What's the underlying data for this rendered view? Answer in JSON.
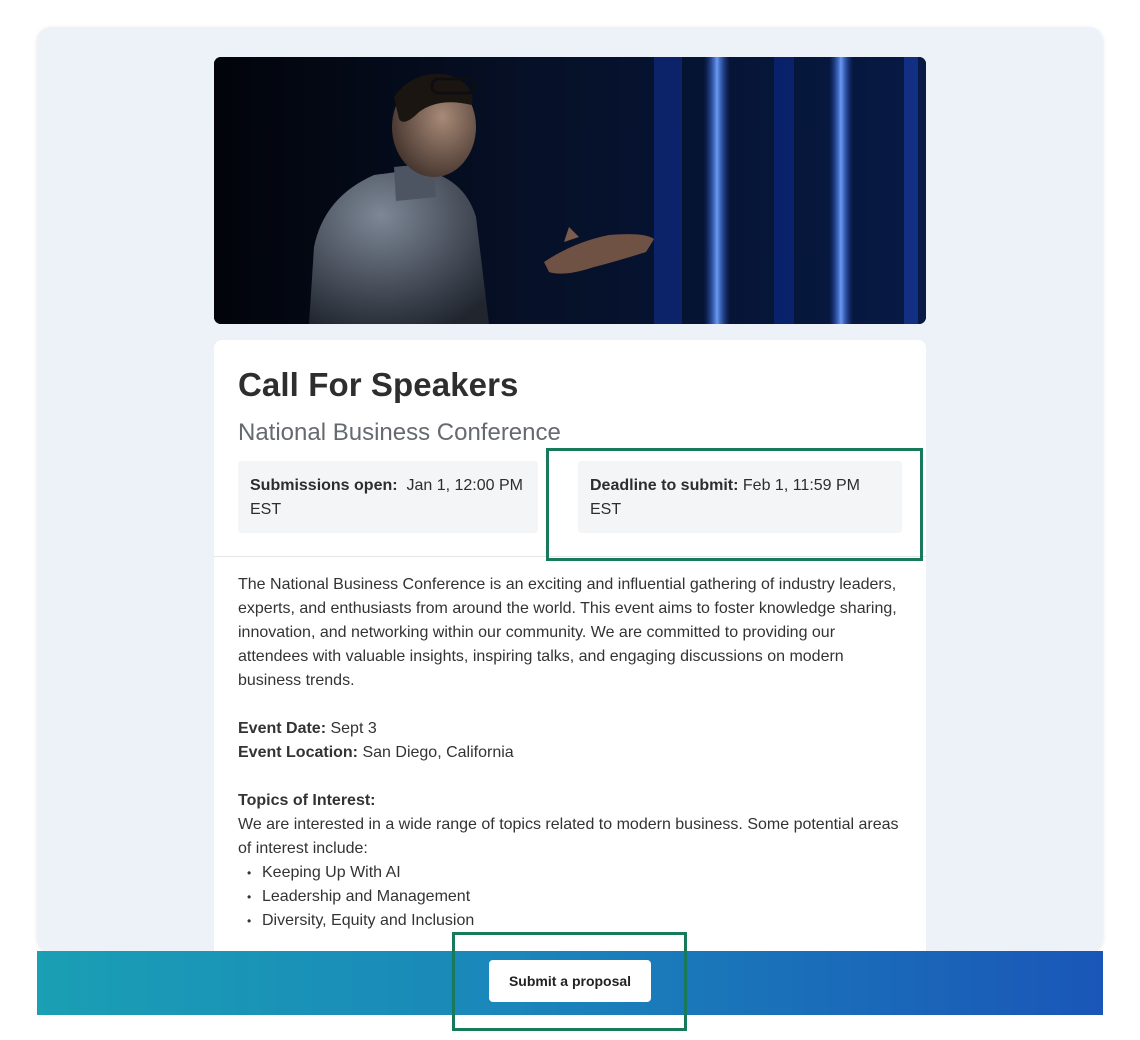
{
  "header": {
    "title": "Call For Speakers",
    "subtitle": "National Business Conference"
  },
  "dates": {
    "open_label": "Submissions open:",
    "open_value": "Jan 1, 12:00 PM EST",
    "deadline_label": "Deadline to submit:",
    "deadline_value": "Feb 1, 11:59 PM EST"
  },
  "description": "The National Business Conference is an exciting and influential gathering of industry leaders, experts, and enthusiasts from around the world. This event aims to foster knowledge sharing, innovation, and networking within our community. We are committed to providing our attendees with valuable insights, inspiring talks, and engaging discussions on modern business trends.",
  "event": {
    "date_label": "Event Date:",
    "date_value": "Sept 3",
    "location_label": "Event Location:",
    "location_value": "San Diego, California"
  },
  "topics": {
    "heading": "Topics of Interest:",
    "intro": "We are interested in a wide range of topics related to modern business. Some potential areas of interest include:",
    "items": [
      "Keeping Up With AI",
      "Leadership and Management",
      "Diversity, Equity and Inclusion"
    ]
  },
  "footer": {
    "submit_label": "Submit a proposal"
  },
  "colors": {
    "highlight": "#177a5b",
    "footer_start": "#1a9fb4",
    "footer_end": "#1a56b8"
  }
}
